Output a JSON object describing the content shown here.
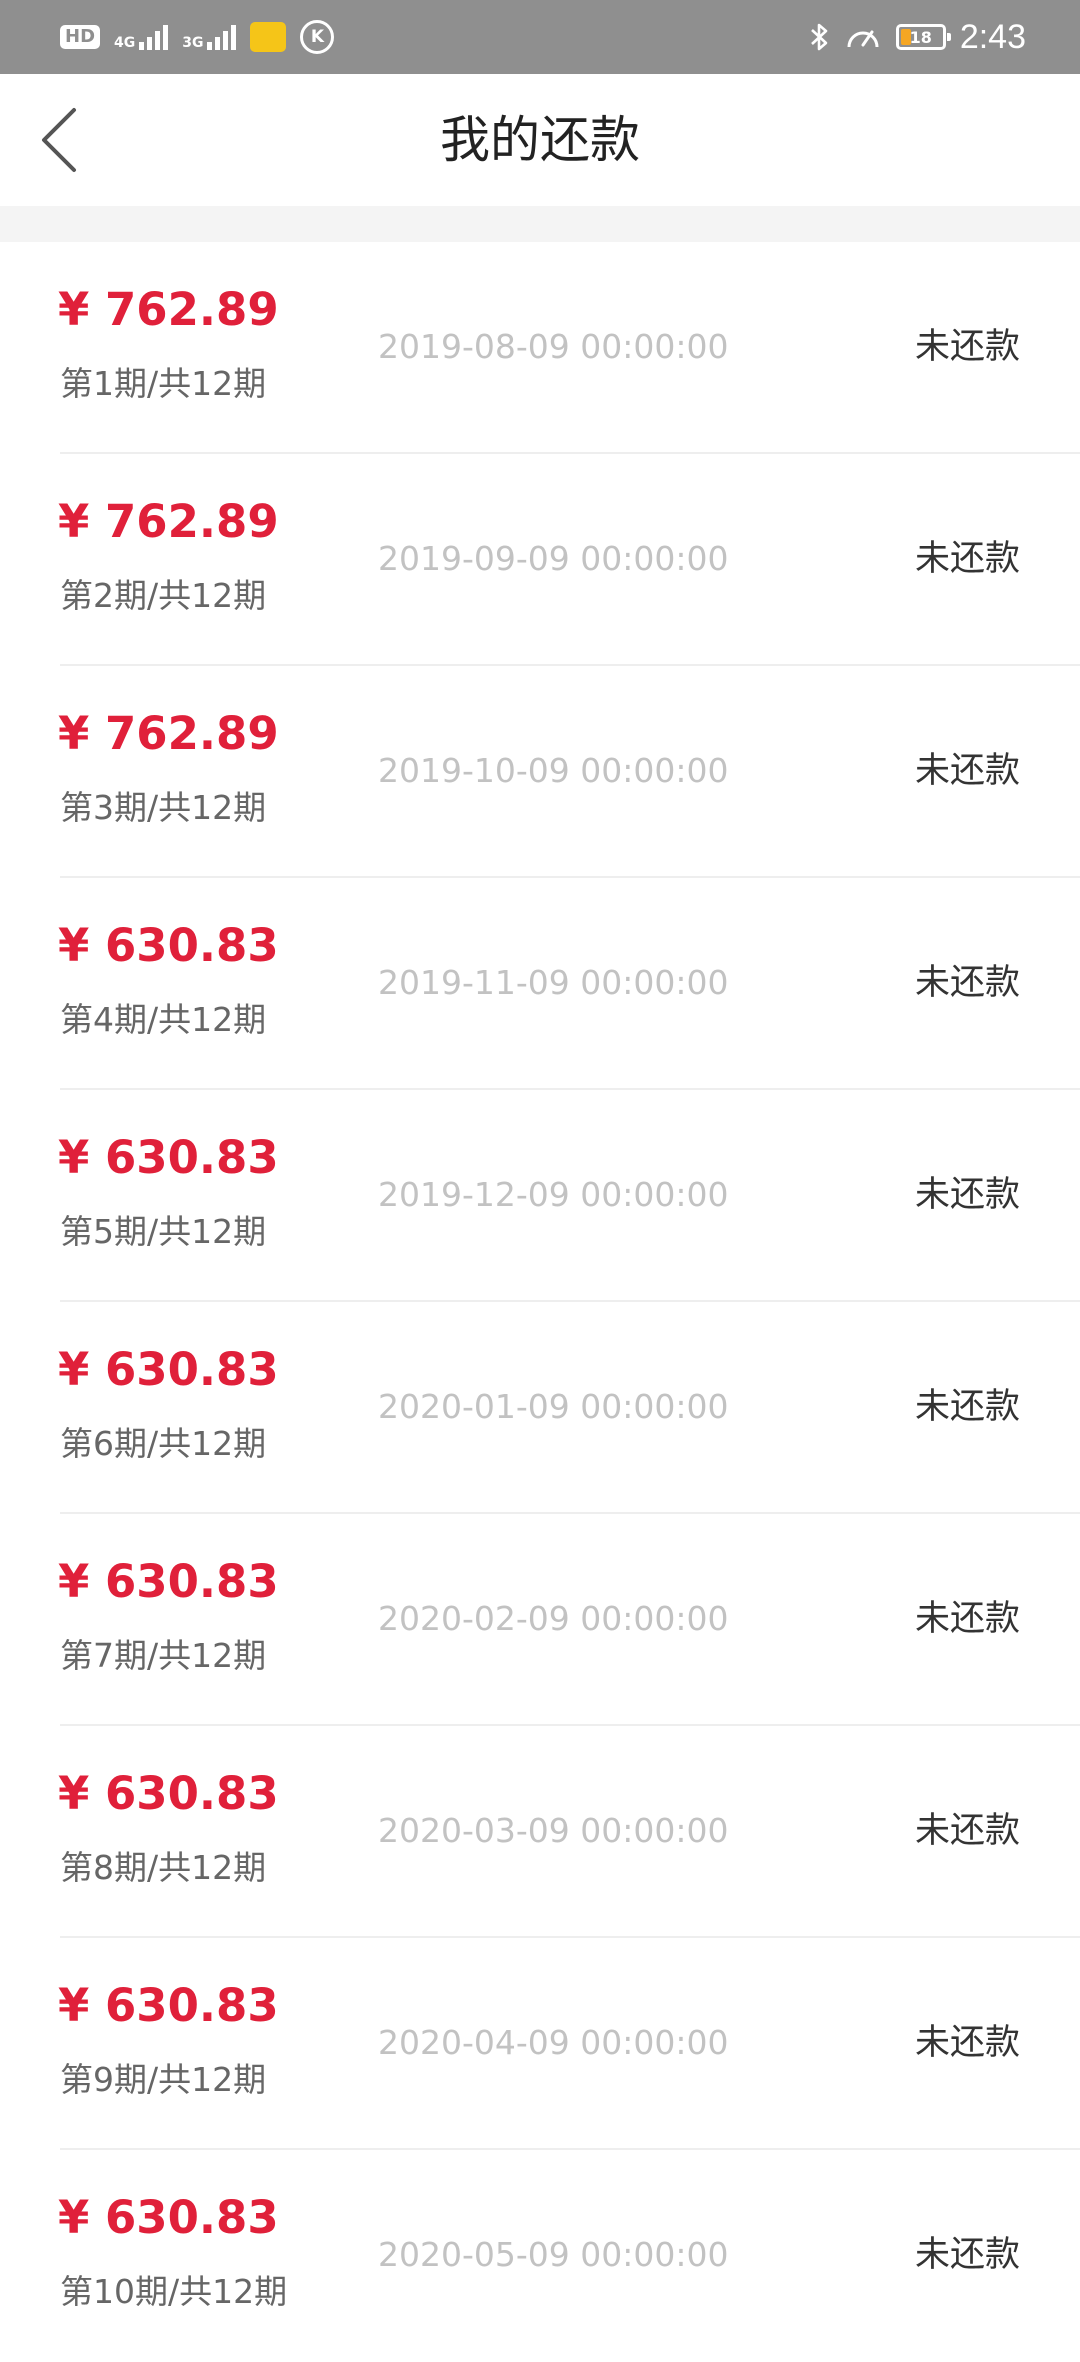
{
  "status_bar": {
    "hd": "HD",
    "net1": "4G",
    "net2": "3G",
    "clock": "2:43",
    "battery": "18",
    "icons": [
      "signal-icon",
      "app-notification-icon",
      "k-circle-icon",
      "bluetooth-icon",
      "speed-icon",
      "battery-icon"
    ]
  },
  "header": {
    "title": "我的还款",
    "back_icon": "chevron-left-icon"
  },
  "colors": {
    "amount": "#e0203a",
    "status_bar_bg": "#8f8f8f",
    "date_text": "#c2c2c2"
  },
  "repayments": [
    {
      "amount": "¥ 762.89",
      "period": "第1期/共12期",
      "date": "2019-08-09 00:00:00",
      "status": "未还款"
    },
    {
      "amount": "¥ 762.89",
      "period": "第2期/共12期",
      "date": "2019-09-09 00:00:00",
      "status": "未还款"
    },
    {
      "amount": "¥ 762.89",
      "period": "第3期/共12期",
      "date": "2019-10-09 00:00:00",
      "status": "未还款"
    },
    {
      "amount": "¥ 630.83",
      "period": "第4期/共12期",
      "date": "2019-11-09 00:00:00",
      "status": "未还款"
    },
    {
      "amount": "¥ 630.83",
      "period": "第5期/共12期",
      "date": "2019-12-09 00:00:00",
      "status": "未还款"
    },
    {
      "amount": "¥ 630.83",
      "period": "第6期/共12期",
      "date": "2020-01-09 00:00:00",
      "status": "未还款"
    },
    {
      "amount": "¥ 630.83",
      "period": "第7期/共12期",
      "date": "2020-02-09 00:00:00",
      "status": "未还款"
    },
    {
      "amount": "¥ 630.83",
      "period": "第8期/共12期",
      "date": "2020-03-09 00:00:00",
      "status": "未还款"
    },
    {
      "amount": "¥ 630.83",
      "period": "第9期/共12期",
      "date": "2020-04-09 00:00:00",
      "status": "未还款"
    },
    {
      "amount": "¥ 630.83",
      "period": "第10期/共12期",
      "date": "2020-05-09 00:00:00",
      "status": "未还款"
    }
  ]
}
